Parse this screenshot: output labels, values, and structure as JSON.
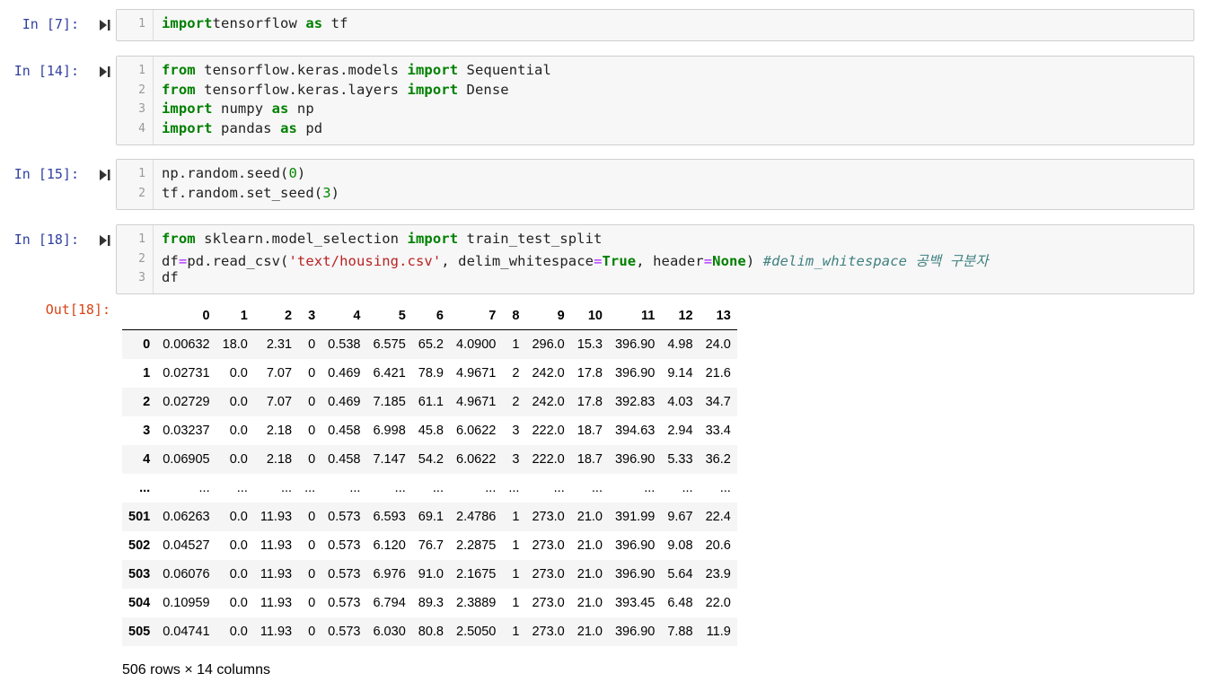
{
  "cells": [
    {
      "prompt": "In [7]:",
      "lines": [
        [
          [
            "kw",
            "import"
          ],
          [
            "",
            "tensorflow "
          ],
          [
            "kw",
            "as"
          ],
          [
            "",
            " tf"
          ]
        ]
      ]
    },
    {
      "prompt": "In [14]:",
      "lines": [
        [
          [
            "kw",
            "from"
          ],
          [
            "",
            " tensorflow.keras.models "
          ],
          [
            "kw",
            "import"
          ],
          [
            "",
            " Sequential"
          ]
        ],
        [
          [
            "kw",
            "from"
          ],
          [
            "",
            " tensorflow.keras.layers "
          ],
          [
            "kw",
            "import"
          ],
          [
            "",
            " Dense"
          ]
        ],
        [
          [
            "kw",
            "import"
          ],
          [
            "",
            " numpy "
          ],
          [
            "kw",
            "as"
          ],
          [
            "",
            " np"
          ]
        ],
        [
          [
            "kw",
            "import"
          ],
          [
            "",
            " pandas "
          ],
          [
            "kw",
            "as"
          ],
          [
            "",
            " pd"
          ]
        ]
      ]
    },
    {
      "prompt": "In [15]:",
      "lines": [
        [
          [
            "",
            "np.random.seed("
          ],
          [
            "num",
            "0"
          ],
          [
            "",
            ")"
          ]
        ],
        [
          [
            "",
            "tf.random.set_seed("
          ],
          [
            "num",
            "3"
          ],
          [
            "",
            ")"
          ]
        ]
      ]
    },
    {
      "prompt": "In [18]:",
      "lines": [
        [
          [
            "kw",
            "from"
          ],
          [
            "",
            " sklearn.model_selection "
          ],
          [
            "kw",
            "import"
          ],
          [
            "",
            " train_test_split"
          ]
        ],
        [
          [
            "",
            "df"
          ],
          [
            "op",
            "="
          ],
          [
            "",
            "pd.read_csv("
          ],
          [
            "str",
            "'text/housing.csv'"
          ],
          [
            "",
            ", delim_whitespace"
          ],
          [
            "op",
            "="
          ],
          [
            "kw",
            "True"
          ],
          [
            "",
            ", header"
          ],
          [
            "op",
            "="
          ],
          [
            "kw",
            "None"
          ],
          [
            "",
            ") "
          ],
          [
            "cmt",
            "#delim_whitespace 공백 구분자"
          ]
        ],
        [
          [
            "",
            "df"
          ]
        ]
      ]
    }
  ],
  "output": {
    "prompt": "Out[18]:",
    "columns": [
      "",
      "0",
      "1",
      "2",
      "3",
      "4",
      "5",
      "6",
      "7",
      "8",
      "9",
      "10",
      "11",
      "12",
      "13"
    ],
    "rows": [
      [
        "0",
        "0.00632",
        "18.0",
        "2.31",
        "0",
        "0.538",
        "6.575",
        "65.2",
        "4.0900",
        "1",
        "296.0",
        "15.3",
        "396.90",
        "4.98",
        "24.0"
      ],
      [
        "1",
        "0.02731",
        "0.0",
        "7.07",
        "0",
        "0.469",
        "6.421",
        "78.9",
        "4.9671",
        "2",
        "242.0",
        "17.8",
        "396.90",
        "9.14",
        "21.6"
      ],
      [
        "2",
        "0.02729",
        "0.0",
        "7.07",
        "0",
        "0.469",
        "7.185",
        "61.1",
        "4.9671",
        "2",
        "242.0",
        "17.8",
        "392.83",
        "4.03",
        "34.7"
      ],
      [
        "3",
        "0.03237",
        "0.0",
        "2.18",
        "0",
        "0.458",
        "6.998",
        "45.8",
        "6.0622",
        "3",
        "222.0",
        "18.7",
        "394.63",
        "2.94",
        "33.4"
      ],
      [
        "4",
        "0.06905",
        "0.0",
        "2.18",
        "0",
        "0.458",
        "7.147",
        "54.2",
        "6.0622",
        "3",
        "222.0",
        "18.7",
        "396.90",
        "5.33",
        "36.2"
      ],
      [
        "...",
        "...",
        "...",
        "...",
        "...",
        "...",
        "...",
        "...",
        "...",
        "...",
        "...",
        "...",
        "...",
        "...",
        "..."
      ],
      [
        "501",
        "0.06263",
        "0.0",
        "11.93",
        "0",
        "0.573",
        "6.593",
        "69.1",
        "2.4786",
        "1",
        "273.0",
        "21.0",
        "391.99",
        "9.67",
        "22.4"
      ],
      [
        "502",
        "0.04527",
        "0.0",
        "11.93",
        "0",
        "0.573",
        "6.120",
        "76.7",
        "2.2875",
        "1",
        "273.0",
        "21.0",
        "396.90",
        "9.08",
        "20.6"
      ],
      [
        "503",
        "0.06076",
        "0.0",
        "11.93",
        "0",
        "0.573",
        "6.976",
        "91.0",
        "2.1675",
        "1",
        "273.0",
        "21.0",
        "396.90",
        "5.64",
        "23.9"
      ],
      [
        "504",
        "0.10959",
        "0.0",
        "11.93",
        "0",
        "0.573",
        "6.794",
        "89.3",
        "2.3889",
        "1",
        "273.0",
        "21.0",
        "393.45",
        "6.48",
        "22.0"
      ],
      [
        "505",
        "0.04741",
        "0.0",
        "11.93",
        "0",
        "0.573",
        "6.030",
        "80.8",
        "2.5050",
        "1",
        "273.0",
        "21.0",
        "396.90",
        "7.88",
        "11.9"
      ]
    ],
    "shape_text": "506 rows × 14 columns"
  },
  "colors": {
    "prompt_in": "#303f9f",
    "prompt_out": "#d84315",
    "keyword": "#008000",
    "string": "#ba2121",
    "comment": "#408080"
  },
  "icons": {
    "run": "run-cell-icon"
  }
}
